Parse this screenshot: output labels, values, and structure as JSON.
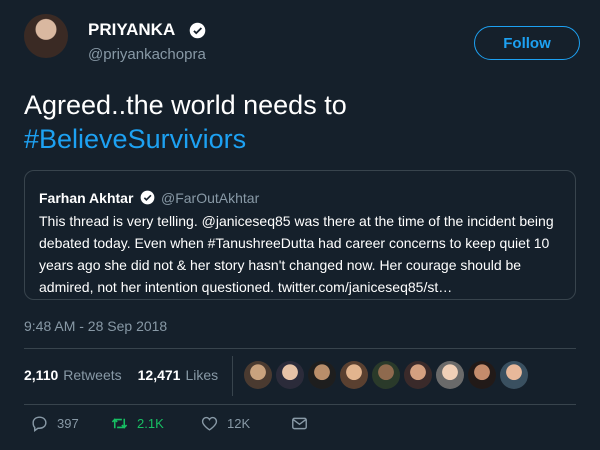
{
  "header": {
    "name": "PRIYANKA",
    "handle": "@priyankachopra",
    "follow_label": "Follow"
  },
  "tweet": {
    "text_line1": "Agreed..the world needs to",
    "hashtag": "#BelieveSurviviors"
  },
  "quote": {
    "name": "Farhan Akhtar",
    "handle": "@FarOutAkhtar",
    "text": "This thread is very telling. @janiceseq85 was there at the time of the incident being debated today. Even when #TanushreeDutta had career concerns to keep quiet 10 years ago she did not & her story hasn't changed now. Her courage should be admired, not her intention questioned. twitter.com/janiceseq85/st…"
  },
  "timestamp": "9:48 AM - 28 Sep 2018",
  "stats": {
    "retweets_count": "2,110",
    "retweets_label": "Retweets",
    "likes_count": "12,471",
    "likes_label": "Likes"
  },
  "actions": {
    "reply_count": "397",
    "retweet_count": "2.1K",
    "like_count": "12K"
  },
  "colors": {
    "background": "#15202b",
    "accent": "#1da1f2",
    "retweet": "#17bf63",
    "muted": "#8899a6"
  },
  "icons": [
    "verified-badge-icon",
    "reply-icon",
    "retweet-icon",
    "like-heart-icon",
    "direct-message-icon"
  ]
}
